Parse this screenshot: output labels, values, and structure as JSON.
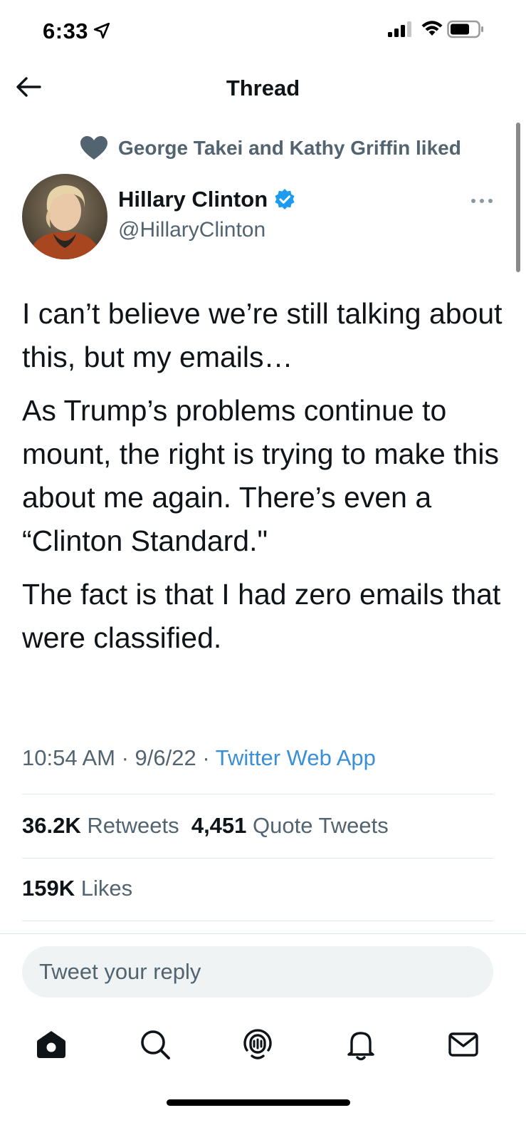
{
  "status_bar": {
    "time": "6:33",
    "icons": [
      "location-arrow-icon",
      "signal-icon",
      "wifi-icon",
      "battery-icon"
    ]
  },
  "header": {
    "title": "Thread",
    "back_icon": "arrow-left-icon"
  },
  "social_context": {
    "icon": "heart-icon",
    "text": "George Takei and Kathy Griffin liked"
  },
  "author": {
    "name": "Hillary Clinton",
    "handle": "@HillaryClinton",
    "verified": true,
    "verified_icon": "verified-badge-icon"
  },
  "tweet": {
    "paragraphs": [
      "I can’t believe we’re still talking about this, but my emails…",
      "As Trump’s problems continue to mount, the right is trying to make this about me again. There’s even a “Clinton Standard.\"",
      "The fact is that I had zero emails that were classified."
    ],
    "time": "10:54 AM",
    "date": "9/6/22",
    "source": "Twitter Web App",
    "separator": " · "
  },
  "stats": {
    "retweets_count": "36.2K",
    "retweets_label": "Retweets",
    "quotes_count": "4,451",
    "quotes_label": "Quote Tweets",
    "likes_count": "159K",
    "likes_label": "Likes"
  },
  "reply": {
    "placeholder": "Tweet your reply"
  },
  "tab_bar": {
    "tabs": [
      "home-icon",
      "search-icon",
      "spaces-icon",
      "notifications-icon",
      "messages-icon"
    ],
    "active": "home-icon"
  },
  "colors": {
    "text_primary": "#0f1419",
    "text_secondary": "#536471",
    "link": "#3a8fd6",
    "verified": "#1d9bf0",
    "divider": "#e1e8ed",
    "reply_bg": "#eff3f4"
  }
}
